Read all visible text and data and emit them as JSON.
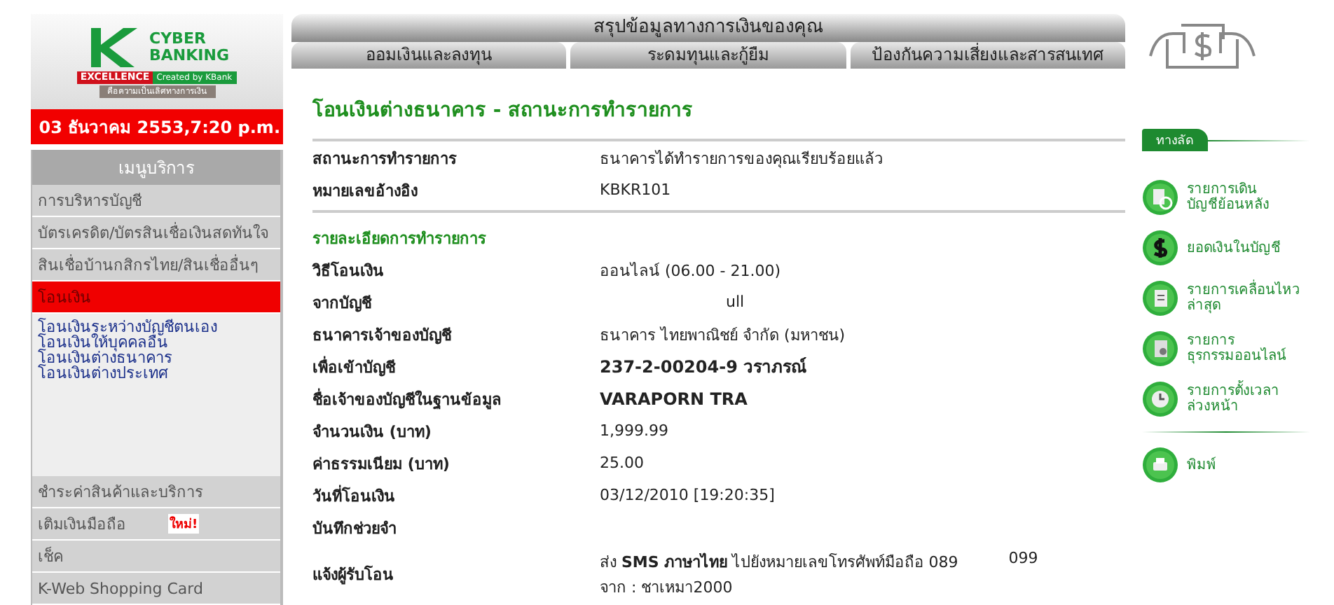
{
  "logo": {
    "line1": "CYBER",
    "line2": "BANKING",
    "badge": "EXCELLENCE",
    "badge_note": "Created by KBank",
    "tagline": "คือความเป็นเลิศทางการเงิน"
  },
  "datetime": "03 ธันวาคม 2553,7:20 p.m.",
  "menu": {
    "title": "เมนูบริการ",
    "items": [
      {
        "label": "การบริหารบัญชี",
        "selected": false
      },
      {
        "label": "บัตรเครดิต/บัตรสินเชื่อเงินสดทันใจ",
        "selected": false
      },
      {
        "label": "สินเชื่อบ้านกสิกรไทย/สินเชื่ออื่นๆ",
        "selected": false
      },
      {
        "label": "โอนเงิน",
        "selected": true,
        "children": [
          "โอนเงินระหว่างบัญชีตนเอง",
          "โอนเงินให้บุคคลอื่น",
          "โอนเงินต่างธนาคาร",
          "โอนเงินต่างประเทศ"
        ]
      },
      {
        "label": "ชำระค่าสินค้าและบริการ",
        "selected": false
      },
      {
        "label": "เติมเงินมือถือ",
        "selected": false,
        "badge": "ใหม่!"
      },
      {
        "label": "เช็ค",
        "selected": false
      },
      {
        "label": "K-Web Shopping Card",
        "selected": false
      }
    ]
  },
  "tabs": {
    "header": "สรุปข้อมูลทางการเงินของคุณ",
    "items": [
      {
        "label": "ออมเงินและลงทุน",
        "selected": false
      },
      {
        "label": "ระดมทุนและกู้ยืม",
        "selected": false
      },
      {
        "label": "ป้องกันความเสี่ยงและสารสนเทศ",
        "selected": false
      }
    ]
  },
  "page_title": "โอนเงินต่างธนาคาร - สถานะการทำรายการ",
  "summary": [
    {
      "label": "สถานะการทำรายการ",
      "value": "ธนาคารได้ทำรายการของคุณเรียบร้อยแล้ว"
    },
    {
      "label": "หมายเลขอ้างอิง",
      "value": "KBKR101"
    }
  ],
  "section_title": "รายละเอียดการทำรายการ",
  "details": [
    {
      "label": "วิธีโอนเงิน",
      "value": "ออนไลน์ (06.00 - 21.00)",
      "bold": false
    },
    {
      "label": "จากบัญชี",
      "value": "ull",
      "bold": false,
      "indent": true
    },
    {
      "label": "ธนาคารเจ้าของบัญชี",
      "value": "ธนาคาร ไทยพาณิชย์ จำกัด (มหาชน)",
      "bold": false
    },
    {
      "label": "เพื่อเข้าบัญชี",
      "value": "237-2-00204-9 วราภรณ์",
      "bold": true
    },
    {
      "label": "ชื่อเจ้าของบัญชีในฐานข้อมูล",
      "value": "VARAPORN TRA",
      "bold": true
    },
    {
      "label": "จำนวนเงิน (บาท)",
      "value": "1,999.99",
      "bold": false
    },
    {
      "label": "ค่าธรรมเนียม (บาท)",
      "value": "25.00",
      "bold": false
    },
    {
      "label": "วันที่โอนเงิน",
      "value": "03/12/2010 [19:20:35]",
      "bold": false
    },
    {
      "label": "บันทึกช่วยจำ"
    },
    {
      "label": "แจ้งผู้รับโอน",
      "value": "ส่ง **SMS** **ภาษาไทย** ไปยังหมายเลขโทรศัพท์มือถือ 089",
      "value_extra": "099",
      "value_line2": "จาก : ชาเหมา2000"
    }
  ],
  "shortcuts": {
    "title": "ทางลัด",
    "items": [
      {
        "kind": "history",
        "label": "รายการเดิน\nบัญชีย้อนหลัง"
      },
      {
        "kind": "balance",
        "label": "ยอดเงินในบัญชี"
      },
      {
        "kind": "statement",
        "label": "รายการเคลื่อนไหว\nล่าสุด"
      },
      {
        "kind": "online",
        "label": "รายการ\nธุรกรรมออนไลน์"
      },
      {
        "kind": "schedule",
        "label": "รายการตั้งเวลา\nล่วงหน้า"
      }
    ],
    "print": "พิมพ์"
  }
}
